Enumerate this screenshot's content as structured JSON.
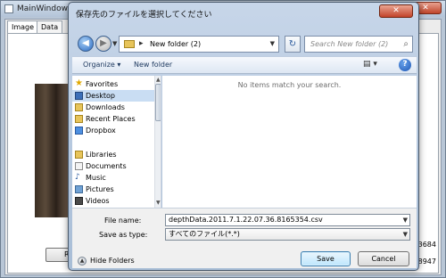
{
  "main_window": {
    "title": "MainWindow",
    "tabs": [
      {
        "label": "Image"
      },
      {
        "label": "Data"
      }
    ],
    "record_button_label": "Rec",
    "readouts": [
      "4.73684",
      "5.78947"
    ]
  },
  "dialog": {
    "title": "保存先のファイルを選択してください",
    "close_label": "✕",
    "address": {
      "path": "New folder (2)"
    },
    "search": {
      "placeholder": "Search New folder (2)"
    },
    "toolbar": {
      "organize_label": "Organize ▾",
      "new_folder_label": "New folder"
    },
    "nav": {
      "favorites_header": "Favorites",
      "items": [
        {
          "label": "Desktop",
          "selected": true
        },
        {
          "label": "Downloads"
        },
        {
          "label": "Recent Places"
        },
        {
          "label": "Dropbox"
        }
      ],
      "libraries_header": "Libraries",
      "libraries": [
        {
          "label": "Documents"
        },
        {
          "label": "Music"
        },
        {
          "label": "Pictures"
        },
        {
          "label": "Videos"
        }
      ]
    },
    "empty_message": "No items match your search.",
    "file_name_label": "File name:",
    "file_name_value": "depthData.2011.7.1.22.07.36.8165354.csv",
    "save_type_label": "Save as type:",
    "save_type_value": "すべてのファイル(*.*)",
    "hide_folders_label": "Hide Folders",
    "save_label": "Save",
    "cancel_label": "Cancel"
  }
}
